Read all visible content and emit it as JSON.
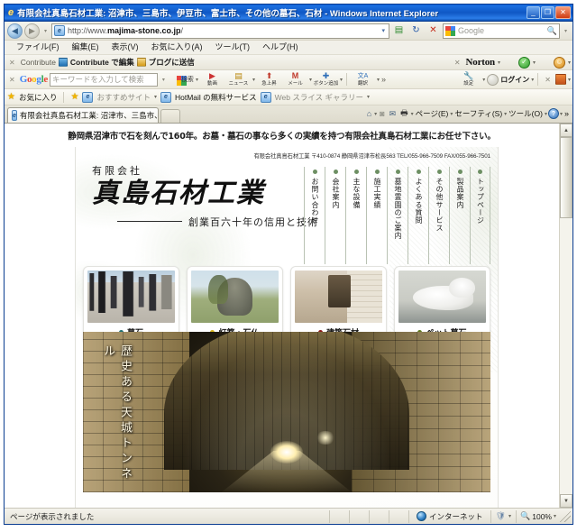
{
  "window": {
    "title": "有限会社真島石材工業: 沼津市、三島市、伊豆市、富士市、その他の墓石、石材 - Windows Internet Explorer",
    "minimize": "_",
    "maximize": "❐",
    "close": "✕"
  },
  "address": {
    "back": "◀",
    "forward": "▶",
    "recent_caret": "▾",
    "url_prefix": "http://www.",
    "url_bold": "majima-stone.co.jp",
    "url_suffix": "/",
    "dropdown_caret": "▾",
    "compat_icon": "▤",
    "refresh_icon": "↻",
    "stop_icon": "✕",
    "search_placeholder": "Google",
    "search_caret": "▾",
    "go_icon": "🔍"
  },
  "menubar": {
    "items": [
      "ファイル(F)",
      "編集(E)",
      "表示(V)",
      "お気に入り(A)",
      "ツール(T)",
      "ヘルプ(H)"
    ]
  },
  "contribute_bar": {
    "close": "✕",
    "name": "Contribute",
    "edit_label": "Contribute で編集",
    "blog_label": "ブログに送信",
    "norton_close": "✕",
    "norton_label": "Norton",
    "norton_caret": "▾",
    "status_caret": "▾",
    "identity_caret": "▾"
  },
  "google_bar": {
    "close": "✕",
    "logo": [
      "G",
      "o",
      "o",
      "g",
      "l",
      "e"
    ],
    "search_placeholder": "キーワードを入力して検索",
    "search_caret": "▾",
    "search_button": "検索",
    "search_caret2": "▾",
    "tools": [
      {
        "label": "動画",
        "icon": "▶"
      },
      {
        "label": "ニュース",
        "icon": "📰"
      },
      {
        "label": "急上昇",
        "icon": "▲"
      },
      {
        "label": "メール",
        "icon": "M"
      },
      {
        "label": "ボタン追加",
        "icon": "✚"
      },
      {
        "label": "翻訳",
        "icon": "訳"
      }
    ],
    "more": "»",
    "settings_label": "設定",
    "settings_icon": "🔧",
    "login_label": "ログイン",
    "login_caret": "▾",
    "right_close": "✕",
    "right_caret": "▾"
  },
  "favorites_bar": {
    "star_icon": "★",
    "favorites_label": "お気に入り",
    "items": [
      {
        "label": "おすすめサイト",
        "caret": "▾",
        "dim": true
      },
      {
        "label": "HotMail の無料サービス",
        "caret": "",
        "dim": false
      },
      {
        "label": "Web スライス ギャラリー",
        "caret": "▾",
        "dim": true
      }
    ]
  },
  "tab_row": {
    "tab_title": "有限会社真島石材工業: 沼津市、三島市、伊豆市、..",
    "new_tab_tooltip": "",
    "commands": [
      {
        "name": "home-icon",
        "glyph": "⌂",
        "caret": "▾"
      },
      {
        "name": "feeds-icon",
        "glyph": "◙",
        "caret": ""
      },
      {
        "name": "mail-icon",
        "glyph": "✉",
        "caret": ""
      },
      {
        "name": "print-icon",
        "glyph": "🖶",
        "caret": "▾"
      }
    ],
    "menus": [
      {
        "label": "ページ(E)",
        "caret": "▾"
      },
      {
        "label": "セーフティ(S)",
        "caret": "▾"
      },
      {
        "label": "ツール(O)",
        "caret": "▾"
      }
    ],
    "help": "?",
    "help_caret": "▾",
    "overflow": "»"
  },
  "page": {
    "headline": "静岡県沼津市で石を刻んで160年。お墓・墓石の事なら多くの実績を持つ有限会社真島石材工業にお任せ下さい。",
    "contact_line": "有限会社真島石材工業  〒410-0874 静岡県沼津市松長563  TEL/055-966-7509  FAX/055-966-7501",
    "brand": {
      "sub": "有限会社",
      "main": "真島石材工業",
      "tagline": "創業百六十年の信用と技術"
    },
    "nav": [
      {
        "label": "トップページ",
        "dot": "#6d8f63"
      },
      {
        "label": "製品案内",
        "dot": "#6d8f63"
      },
      {
        "label": "その他サービス",
        "dot": "#6d8f63"
      },
      {
        "label": "よくある質問",
        "dot": "#6d8f63"
      },
      {
        "label": "墓地霊園のご案内",
        "dot": "#6d8f63"
      },
      {
        "label": "施工実績",
        "dot": "#6d8f63"
      },
      {
        "label": "主な設備",
        "dot": "#6d8f63"
      },
      {
        "label": "会社案内",
        "dot": "#6d8f63"
      },
      {
        "label": "お問い合わせ",
        "dot": "#6d8f63"
      }
    ],
    "cards": [
      {
        "label": "墓石",
        "dot": "#1f6f72",
        "photo": "ph-grave"
      },
      {
        "label": "灯篭・石仏",
        "dot": "#d4b21a",
        "photo": "ph-buddha"
      },
      {
        "label": "建築石材",
        "dot": "#8c1b1b",
        "photo": "ph-entry"
      },
      {
        "label": "ペット墓石",
        "dot": "#5e7a1e",
        "photo": "ph-dog"
      }
    ],
    "banner": {
      "caption": "歴史ある天城トンネル"
    }
  },
  "scrollbar": {
    "up": "▲",
    "down": "▼"
  },
  "statusbar": {
    "message": "ページが表示されました",
    "zone": "インターネット",
    "security_caret": "▾",
    "zoom": "100%",
    "zoom_caret": "▾"
  }
}
